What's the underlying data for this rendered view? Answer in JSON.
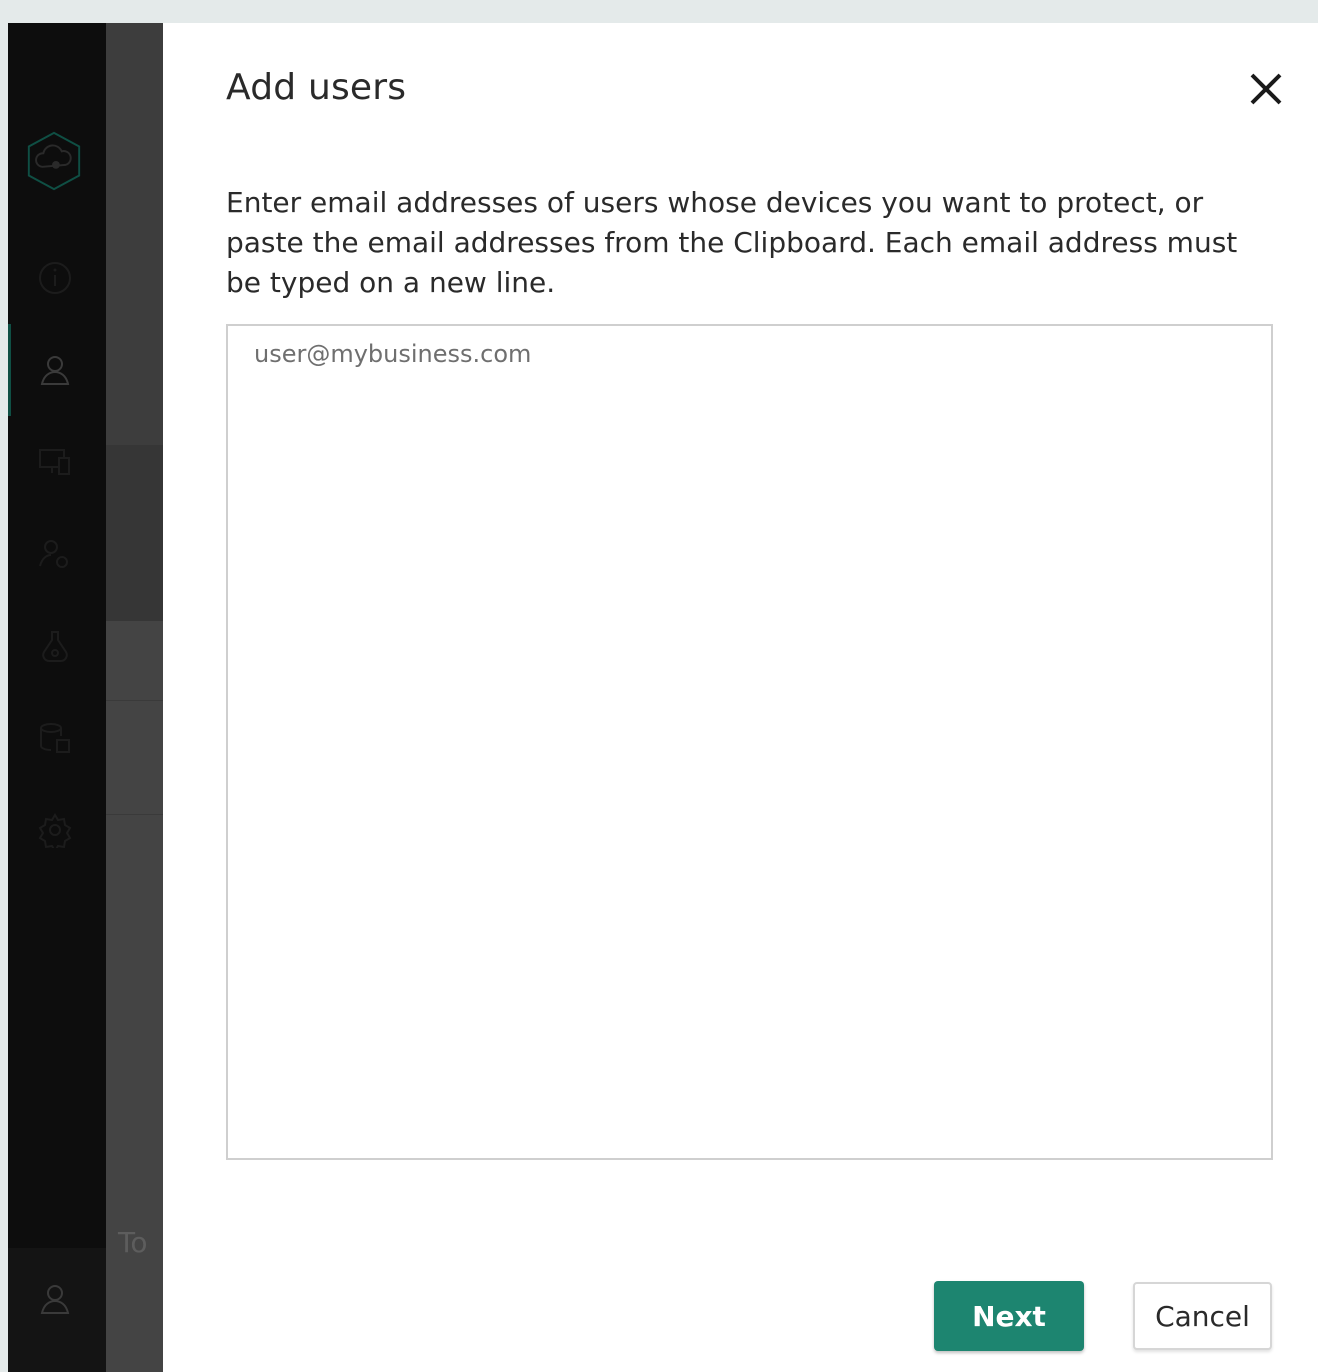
{
  "dialog": {
    "title": "Add users",
    "instructions": "Enter email addresses of users whose devices you want to protect, or paste the email addresses from the Clipboard. Each email address must be typed on a new line.",
    "emails_field": {
      "placeholder": "user@mybusiness.com",
      "value": ""
    },
    "next_label": "Next",
    "cancel_label": "Cancel"
  },
  "sidebar": {
    "items": [
      {
        "icon": "cloud-shield-icon"
      },
      {
        "icon": "info-icon"
      },
      {
        "icon": "user-icon",
        "active": true
      },
      {
        "icon": "devices-icon"
      },
      {
        "icon": "user-settings-icon"
      },
      {
        "icon": "flask-icon"
      },
      {
        "icon": "database-icon"
      },
      {
        "icon": "gear-icon"
      }
    ],
    "bottom_item": {
      "icon": "user-account-icon"
    }
  },
  "background_peek_text": "To",
  "colors": {
    "accent": "#1d8570",
    "rail_bg": "#0d0d0d",
    "page_bg": "#e4eaea"
  }
}
